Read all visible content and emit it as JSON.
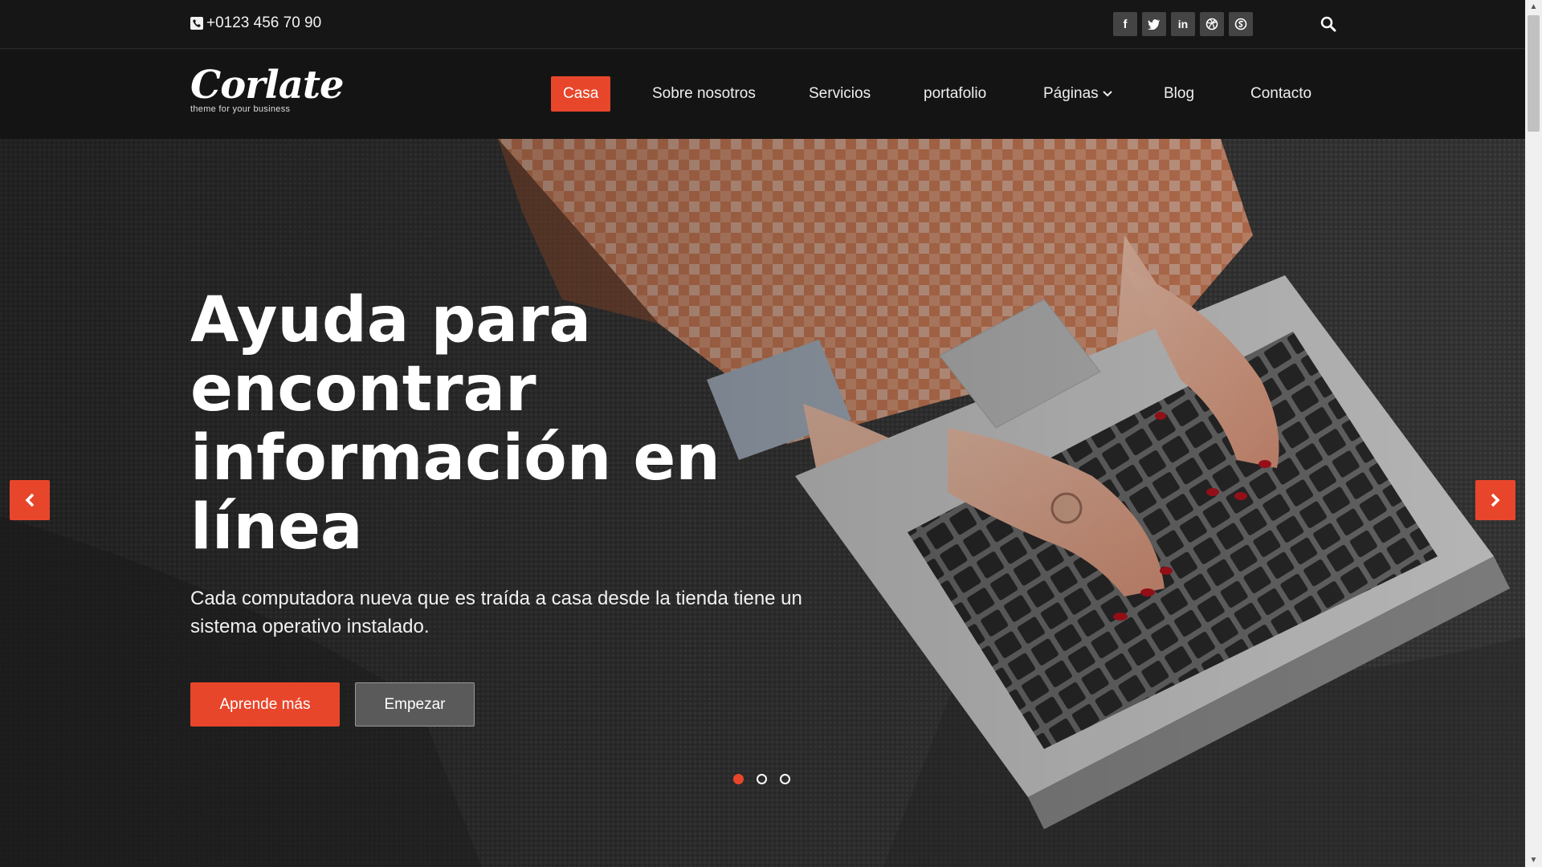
{
  "topbar": {
    "phone": "+0123 456 70 90",
    "social": [
      {
        "icon": "facebook-icon",
        "glyph": "f"
      },
      {
        "icon": "twitter-icon",
        "glyph": "t"
      },
      {
        "icon": "linkedin-icon",
        "glyph": "in"
      },
      {
        "icon": "dribbble-icon",
        "glyph": "◎"
      },
      {
        "icon": "skype-icon",
        "glyph": "S"
      }
    ],
    "search_icon": "search-icon"
  },
  "nav": {
    "logo_text": "Corlate",
    "logo_tagline": "theme for your business",
    "items": [
      {
        "label": "Casa",
        "active": true
      },
      {
        "label": "Sobre nosotros",
        "active": false
      },
      {
        "label": "Servicios",
        "active": false
      },
      {
        "label": "portafolio",
        "active": false
      },
      {
        "label": "Páginas",
        "active": false,
        "dropdown": true
      },
      {
        "label": "Blog",
        "active": false
      },
      {
        "label": "Contacto",
        "active": false
      }
    ]
  },
  "hero": {
    "headline": "Ayuda para encontrar información en línea",
    "subtext": "Cada computadora nueva que es traída a casa desde la tienda tiene un sistema operativo instalado.",
    "primary_button": "Aprende más",
    "secondary_button": "Empezar",
    "slides_total": 3,
    "active_slide": 1
  },
  "colors": {
    "accent": "#e8462b",
    "topbar_bg": "#161616",
    "nav_bg": "#141414"
  }
}
